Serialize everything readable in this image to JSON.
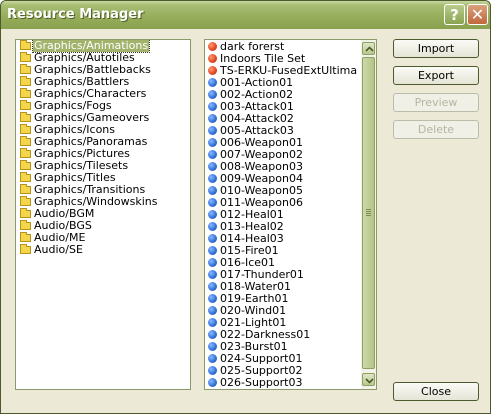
{
  "window": {
    "title": "Resource Manager",
    "help_label": "?",
    "close_label": "✕"
  },
  "folders": {
    "selected_index": 0,
    "items": [
      {
        "label": "Graphics/Animations"
      },
      {
        "label": "Graphics/Autotiles"
      },
      {
        "label": "Graphics/Battlebacks"
      },
      {
        "label": "Graphics/Battlers"
      },
      {
        "label": "Graphics/Characters"
      },
      {
        "label": "Graphics/Fogs"
      },
      {
        "label": "Graphics/Gameovers"
      },
      {
        "label": "Graphics/Icons"
      },
      {
        "label": "Graphics/Panoramas"
      },
      {
        "label": "Graphics/Pictures"
      },
      {
        "label": "Graphics/Tilesets"
      },
      {
        "label": "Graphics/Titles"
      },
      {
        "label": "Graphics/Transitions"
      },
      {
        "label": "Graphics/Windowskins"
      },
      {
        "label": "Audio/BGM"
      },
      {
        "label": "Audio/BGS"
      },
      {
        "label": "Audio/ME"
      },
      {
        "label": "Audio/SE"
      }
    ]
  },
  "resources": {
    "items": [
      {
        "label": "dark forerst",
        "icon": "red"
      },
      {
        "label": "Indoors Tile Set",
        "icon": "red"
      },
      {
        "label": "TS-ERKU-FusedExtUltima",
        "icon": "red"
      },
      {
        "label": "001-Action01",
        "icon": "blue"
      },
      {
        "label": "002-Action02",
        "icon": "blue"
      },
      {
        "label": "003-Attack01",
        "icon": "blue"
      },
      {
        "label": "004-Attack02",
        "icon": "blue"
      },
      {
        "label": "005-Attack03",
        "icon": "blue"
      },
      {
        "label": "006-Weapon01",
        "icon": "blue"
      },
      {
        "label": "007-Weapon02",
        "icon": "blue"
      },
      {
        "label": "008-Weapon03",
        "icon": "blue"
      },
      {
        "label": "009-Weapon04",
        "icon": "blue"
      },
      {
        "label": "010-Weapon05",
        "icon": "blue"
      },
      {
        "label": "011-Weapon06",
        "icon": "blue"
      },
      {
        "label": "012-Heal01",
        "icon": "blue"
      },
      {
        "label": "013-Heal02",
        "icon": "blue"
      },
      {
        "label": "014-Heal03",
        "icon": "blue"
      },
      {
        "label": "015-Fire01",
        "icon": "blue"
      },
      {
        "label": "016-Ice01",
        "icon": "blue"
      },
      {
        "label": "017-Thunder01",
        "icon": "blue"
      },
      {
        "label": "018-Water01",
        "icon": "blue"
      },
      {
        "label": "019-Earth01",
        "icon": "blue"
      },
      {
        "label": "020-Wind01",
        "icon": "blue"
      },
      {
        "label": "021-Light01",
        "icon": "blue"
      },
      {
        "label": "022-Darkness01",
        "icon": "blue"
      },
      {
        "label": "023-Burst01",
        "icon": "blue"
      },
      {
        "label": "024-Support01",
        "icon": "blue"
      },
      {
        "label": "025-Support02",
        "icon": "blue"
      },
      {
        "label": "026-Support03",
        "icon": "blue"
      }
    ]
  },
  "buttons": {
    "import": "Import",
    "export": "Export",
    "preview": "Preview",
    "delete": "Delete",
    "close": "Close"
  },
  "colors": {
    "titlebar": "#96ae5c",
    "selection": "#a2b36b",
    "dialog_bg": "#ecead7",
    "icon_red": "#e0451d",
    "icon_blue": "#2f6fd6"
  }
}
